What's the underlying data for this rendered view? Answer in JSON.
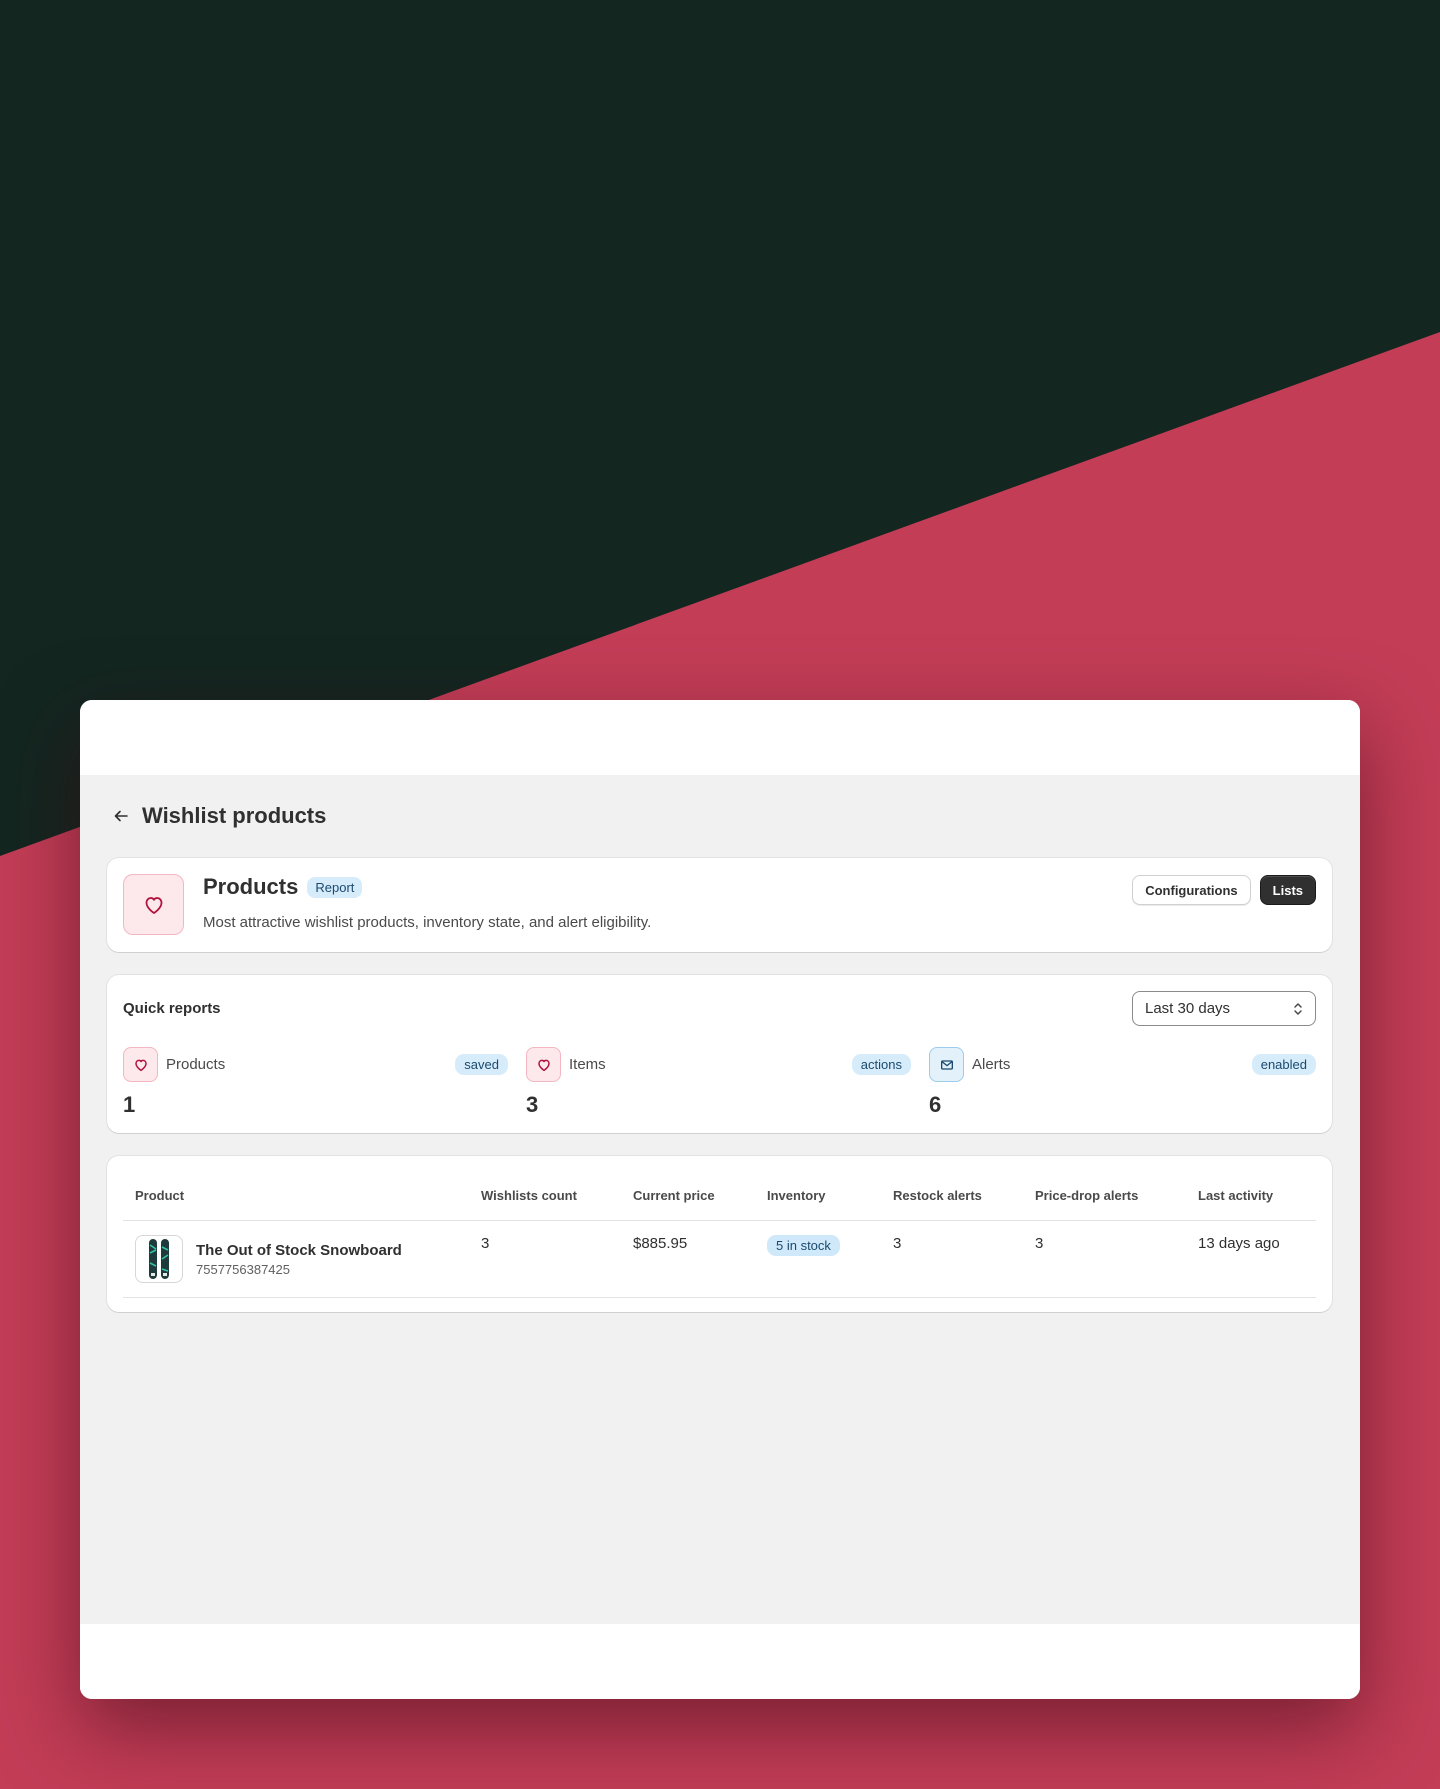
{
  "page": {
    "title": "Wishlist products"
  },
  "header_card": {
    "title": "Products",
    "badge": "Report",
    "description": "Most attractive wishlist products, inventory state, and alert eligibility.",
    "buttons": {
      "configurations": "Configurations",
      "lists": "Lists"
    }
  },
  "quick_reports": {
    "title": "Quick reports",
    "range_select": "Last 30 days",
    "stats": [
      {
        "label": "Products",
        "badge": "saved",
        "value": "1",
        "icon": "heart-icon"
      },
      {
        "label": "Items",
        "badge": "actions",
        "value": "3",
        "icon": "heart-icon"
      },
      {
        "label": "Alerts",
        "badge": "enabled",
        "value": "6",
        "icon": "mail-icon"
      }
    ]
  },
  "table": {
    "columns": [
      "Product",
      "Wishlists count",
      "Current price",
      "Inventory",
      "Restock alerts",
      "Price-drop alerts",
      "Last activity"
    ],
    "rows": [
      {
        "product_name": "The Out of Stock Snowboard",
        "product_id": "7557756387425",
        "wishlists_count": "3",
        "current_price": "$885.95",
        "inventory": "5 in stock",
        "restock_alerts": "3",
        "price_drop_alerts": "3",
        "last_activity": "13 days ago"
      }
    ]
  },
  "colors": {
    "background_dark": "#132620",
    "background_accent": "#c33d57",
    "primary_button": "#303030",
    "badge_blue": "#d6ecfb"
  }
}
